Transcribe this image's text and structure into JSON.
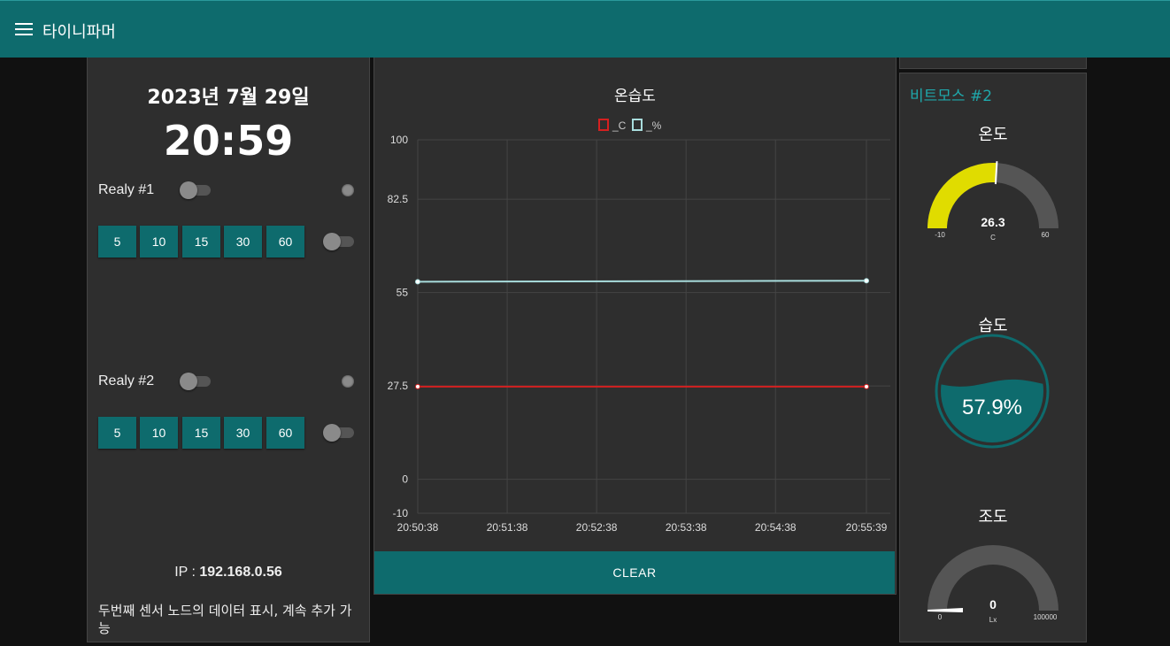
{
  "header": {
    "title": "타이니파머",
    "menu_icon": "hamburger-menu-icon"
  },
  "clock": {
    "date": "2023년 7월 29일",
    "time": "20:59"
  },
  "relays": [
    {
      "label": "Realy #1",
      "timer_buttons": [
        "5",
        "10",
        "15",
        "30",
        "60"
      ]
    },
    {
      "label": "Realy #2",
      "timer_buttons": [
        "5",
        "10",
        "15",
        "30",
        "60"
      ]
    }
  ],
  "ip": {
    "prefix": "IP : ",
    "value": "192.168.0.56"
  },
  "note": "두번째 센서 노드의 데이터 표시, 계속 추가 가능",
  "chart_data": {
    "type": "line",
    "title": "온습도",
    "x": [
      "20:50:38",
      "20:51:38",
      "20:52:38",
      "20:53:38",
      "20:54:38",
      "20:55:39"
    ],
    "ylim": [
      -10,
      100
    ],
    "yticks": [
      "100",
      "82.5",
      "55",
      "27.5",
      "0",
      "-10"
    ],
    "grid": true,
    "legend_position": "top",
    "series": [
      {
        "name": "_C",
        "color": "#d42020",
        "points": [
          [
            "20:50:38",
            27.3
          ],
          [
            "20:55:39",
            27.3
          ]
        ]
      },
      {
        "name": "_%",
        "color": "#a8dcdc",
        "points": [
          [
            "20:50:38",
            58.2
          ],
          [
            "20:55:39",
            58.5
          ]
        ]
      }
    ]
  },
  "chart_clear_label": "CLEAR",
  "sensor_section": {
    "title": "비트모스 #2"
  },
  "temperature_gauge": {
    "title": "온도",
    "value": "26.3",
    "unit": "C",
    "min": "-10",
    "max": "60",
    "fill_color": "#e0dc00"
  },
  "humidity_gauge": {
    "title": "습도",
    "value": "57.9%",
    "level": 0.579,
    "fill_color": "#0e6b6d"
  },
  "light_gauge": {
    "title": "조도",
    "value": "0",
    "unit": "Lx",
    "min": "0",
    "max": "100000"
  },
  "colors": {
    "accent": "#0e6b6d",
    "accent_text": "#1fa8ab",
    "background": "#111111",
    "panel": "#2e2e2e"
  }
}
